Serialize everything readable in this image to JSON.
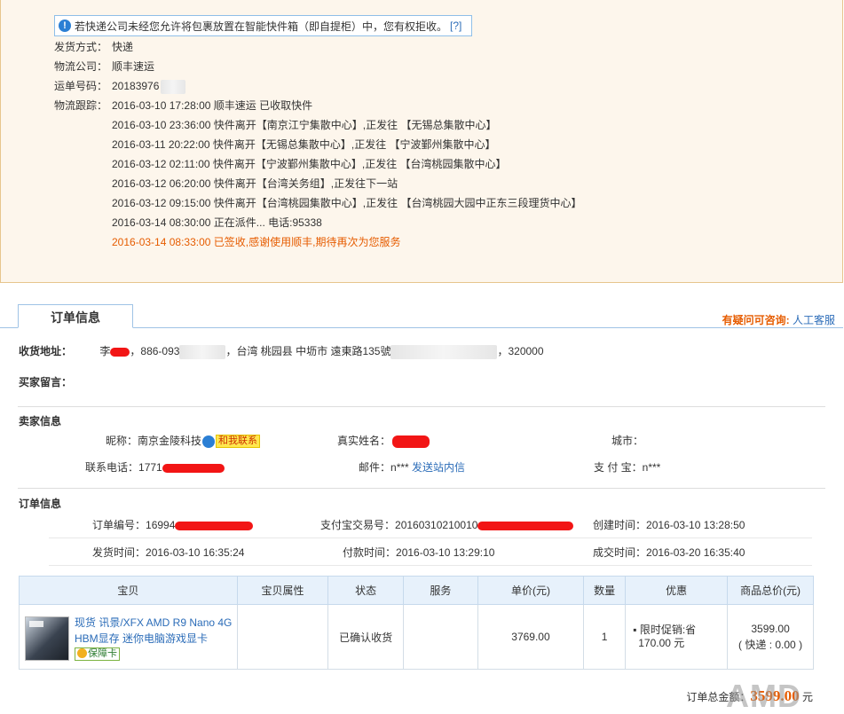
{
  "logistics": {
    "notice": "若快递公司未经您允许将包裹放置在智能快件箱（即自提柜）中，您有权拒收。",
    "notice_help": "[?]",
    "ship_method_label": "发货方式：",
    "ship_method": "快递",
    "company_label": "物流公司：",
    "company": "顺丰速运",
    "waybill_label": "运单号码：",
    "waybill": "20183976",
    "tracking_label": "物流跟踪：",
    "tracking": [
      {
        "time": "2016-03-10 17:28:00",
        "text": "顺丰速运 已收取快件"
      },
      {
        "time": "2016-03-10 23:36:00",
        "text": "快件离开【南京江宁集散中心】,正发往 【无锡总集散中心】"
      },
      {
        "time": "2016-03-11 20:22:00",
        "text": "快件离开【无锡总集散中心】,正发往 【宁波鄞州集散中心】"
      },
      {
        "time": "2016-03-12 02:11:00",
        "text": "快件离开【宁波鄞州集散中心】,正发往 【台湾桃园集散中心】"
      },
      {
        "time": "2016-03-12 06:20:00",
        "text": "快件离开【台湾关务组】,正发往下一站"
      },
      {
        "time": "2016-03-12 09:15:00",
        "text": "快件离开【台湾桃园集散中心】,正发往 【台湾桃园大园中正东三段理货中心】"
      },
      {
        "time": "2016-03-14 08:30:00",
        "text": "正在派件... 电话:95338"
      },
      {
        "time": "2016-03-14 08:33:00",
        "text": "已签收,感谢使用顺丰,期待再次为您服务"
      }
    ]
  },
  "order_tab": "订单信息",
  "help": {
    "question": "有疑问可咨询:",
    "service": "人工客服"
  },
  "address": {
    "label": "收货地址：",
    "name": "李",
    "phone_prefix": "886-093",
    "location": "，台湾 桃园县 中坜市 遠東路135號",
    "zip": "，320000"
  },
  "buyer_message_label": "买家留言：",
  "seller": {
    "section_title": "卖家信息",
    "nickname_label": "昵称：",
    "nickname": "南京金陵科技",
    "contact_badge": "和我联系",
    "realname_label": "真实姓名：",
    "city_label": "城市：",
    "phone_label": "联系电话：",
    "phone": "1771",
    "email_label": "邮件：",
    "email": "n***",
    "send_msg": "发送站内信",
    "alipay_label": "支 付 宝：",
    "alipay": "n***"
  },
  "order": {
    "section_title": "订单信息",
    "order_no_label": "订单编号：",
    "order_no": "16994",
    "alipay_trade_label": "支付宝交易号：",
    "alipay_trade": "20160310210010",
    "created_label": "创建时间：",
    "created": "2016-03-10 13:28:50",
    "shipped_label": "发货时间：",
    "shipped": "2016-03-10 16:35:24",
    "paid_label": "付款时间：",
    "paid": "2016-03-10 13:29:10",
    "deal_label": "成交时间：",
    "deal": "2016-03-20 16:35:40"
  },
  "table": {
    "headers": [
      "宝贝",
      "宝贝属性",
      "状态",
      "服务",
      "单价(元)",
      "数量",
      "优惠",
      "商品总价(元)"
    ],
    "row": {
      "title": "现货 讯景/XFX AMD R9 Nano 4G HBM显存 迷你电脑游戏显卡",
      "guarantee": "保障卡",
      "attr": "",
      "status": "已确认收货",
      "service": "",
      "unit_price": "3769.00",
      "qty": "1",
      "discount_label": "限时促销:省",
      "discount_amount": "170.00 元",
      "total": "3599.00",
      "shipping": "( 快递 : 0.00 )"
    }
  },
  "total": {
    "label": "订单总金额：",
    "amount": "3599.00",
    "unit": "元"
  },
  "watermark": "AMD"
}
